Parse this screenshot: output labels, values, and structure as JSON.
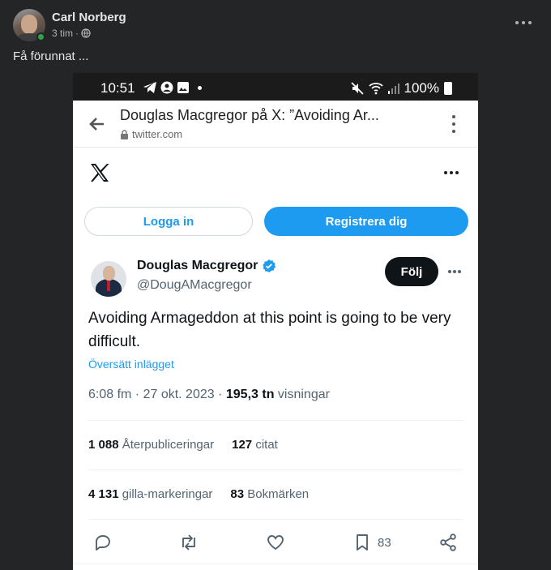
{
  "post": {
    "author": "Carl Norberg",
    "time": "3 tim",
    "separator": "·",
    "text": "Få förunnat ..."
  },
  "screenshot": {
    "status": {
      "time": "10:51",
      "battery": "100%"
    },
    "browser": {
      "title": "Douglas Macgregor på X: ”Avoiding Ar...",
      "url": "twitter.com"
    },
    "buttons": {
      "login": "Logga in",
      "register": "Registrera dig",
      "follow": "Följ"
    },
    "tweet": {
      "name": "Douglas Macgregor",
      "handle": "@DougAMacgregor",
      "body": "Avoiding Armageddon at this point is going to be very difficult.",
      "translate": "Översätt inlägget",
      "timestamp": "6:08 fm · 27 okt. 2023 ·",
      "views_count": "195,3 tn",
      "views_label": "visningar",
      "reposts_count": "1 088",
      "reposts_label": "Återpubliceringar",
      "quotes_count": "127",
      "quotes_label": "citat",
      "likes_count": "4 131",
      "likes_label": "gilla-markeringar",
      "bookmarks_count": "83",
      "bookmarks_label": "Bokmärken",
      "bookmark_action_count": "83"
    },
    "colors": {
      "x_blue": "#1d9bf0",
      "dark": "#0f1419",
      "fb_bg": "#242526"
    },
    "icons": [
      "back-arrow-icon",
      "lock-icon",
      "x-logo-icon",
      "verified-icon",
      "reply-icon",
      "repost-icon",
      "like-icon",
      "bookmark-icon",
      "share-icon"
    ]
  }
}
